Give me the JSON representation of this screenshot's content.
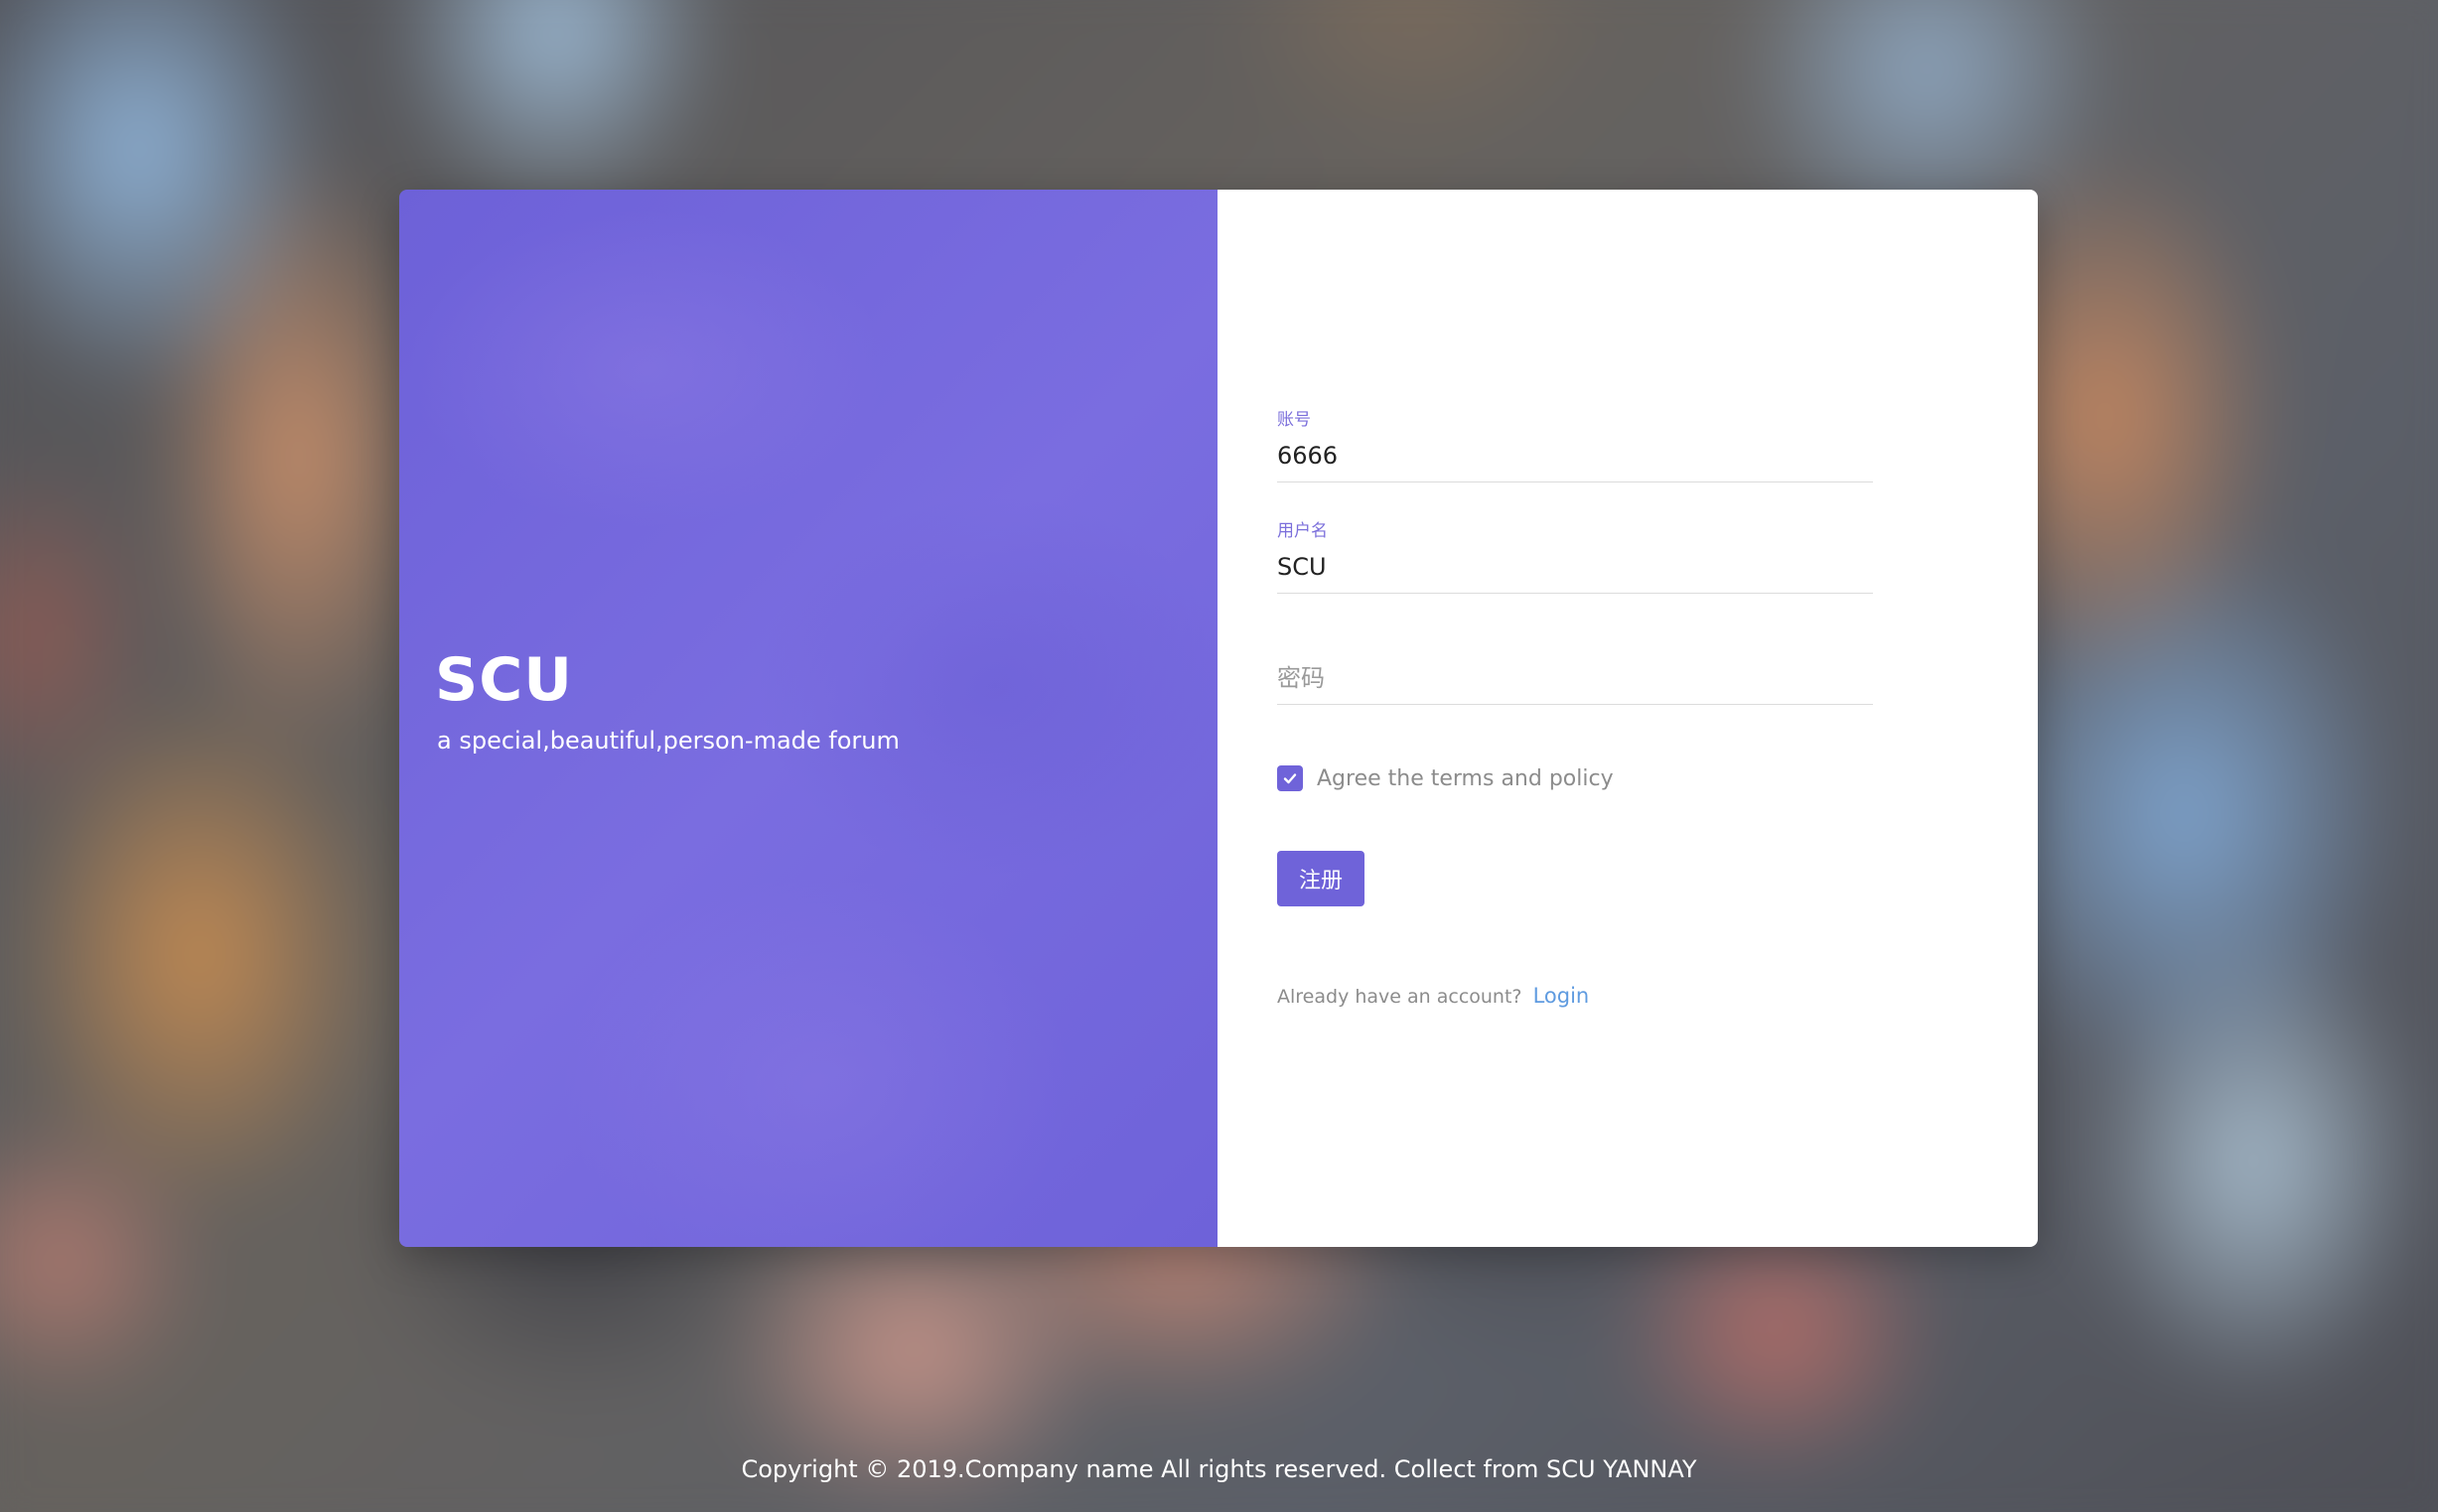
{
  "brand": {
    "title": "SCU",
    "subtitle": "a special,beautiful,person-made forum"
  },
  "form": {
    "account": {
      "label": "账号",
      "value": "6666"
    },
    "username": {
      "label": "用户名",
      "value": "SCU"
    },
    "password": {
      "placeholder": "密码",
      "value": ""
    },
    "agree": {
      "label": "Agree the terms and policy",
      "checked": true,
      "icon": "check-icon"
    },
    "register_label": "注册",
    "login_prompt": "Already have an account?",
    "login_link": "Login"
  },
  "footer": {
    "text": "Copyright © 2019.Company name All rights reserved. Collect from SCU YANNAY"
  },
  "colors": {
    "accent": "#6f63d9",
    "link": "#5f9be0",
    "panel": "#ffffff"
  }
}
